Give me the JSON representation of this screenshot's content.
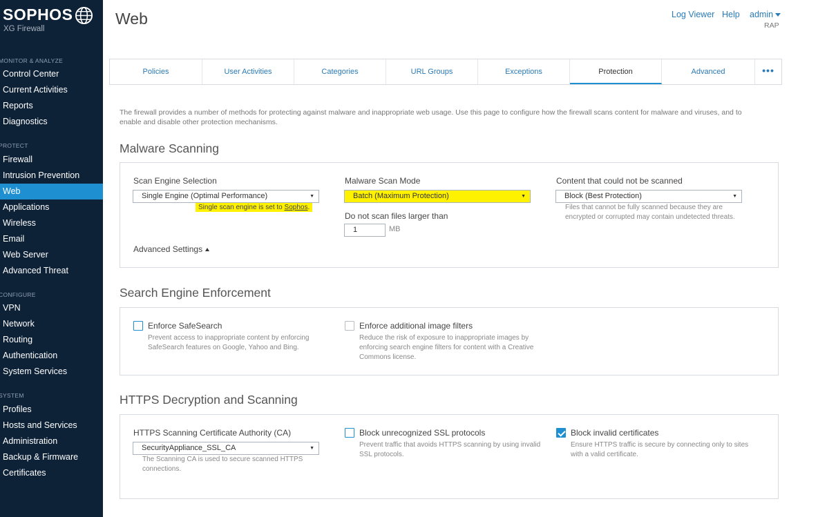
{
  "app": {
    "brand": "SOPHOS",
    "product": "XG Firewall"
  },
  "sidebar": {
    "sections": [
      {
        "label": "MONITOR & ANALYZE",
        "items": [
          "Control Center",
          "Current Activities",
          "Reports",
          "Diagnostics"
        ]
      },
      {
        "label": "PROTECT",
        "items": [
          "Firewall",
          "Intrusion Prevention",
          "Web",
          "Applications",
          "Wireless",
          "Email",
          "Web Server",
          "Advanced Threat"
        ]
      },
      {
        "label": "CONFIGURE",
        "items": [
          "VPN",
          "Network",
          "Routing",
          "Authentication",
          "System Services"
        ]
      },
      {
        "label": "SYSTEM",
        "items": [
          "Profiles",
          "Hosts and Services",
          "Administration",
          "Backup & Firmware",
          "Certificates"
        ]
      }
    ],
    "active": "Web"
  },
  "header": {
    "title": "Web",
    "links": [
      "Log Viewer",
      "Help"
    ],
    "user": "admin",
    "user_sub": "RAP"
  },
  "tabs": [
    "Policies",
    "User Activities",
    "Categories",
    "URL Groups",
    "Exceptions",
    "Protection",
    "Advanced",
    "•••"
  ],
  "active_tab": "Protection",
  "intro": "The firewall provides a number of methods for protecting against malware and inappropriate web usage. Use this page to configure how the firewall scans content for malware and viruses, and to enable and disable other protection mechanisms.",
  "malware": {
    "title": "Malware Scanning",
    "engine_label": "Scan Engine Selection",
    "engine_value": "Single Engine (Optimal Performance)",
    "engine_note_prefix": "Single scan engine is set to ",
    "engine_note_link": "Sophos",
    "engine_note_suffix": ".",
    "mode_label": "Malware Scan Mode",
    "mode_value": "Batch (Maximum Protection)",
    "size_label": "Do not scan files larger than",
    "size_value": "1",
    "size_unit": "MB",
    "unscanned_label": "Content that could not be scanned",
    "unscanned_value": "Block (Best Protection)",
    "unscanned_help": "Files that cannot be fully scanned because they are encrypted or corrupted may contain undetected threats.",
    "advanced": "Advanced Settings"
  },
  "search": {
    "title": "Search Engine Enforcement",
    "safesearch_label": "Enforce SafeSearch",
    "safesearch_checked": false,
    "safesearch_help": "Prevent access to inappropriate content by enforcing SafeSearch features on Google, Yahoo and Bing.",
    "image_label": "Enforce additional image filters",
    "image_checked": false,
    "image_help": "Reduce the risk of exposure to inappropriate images by enforcing search engine filters for content with a Creative Commons license."
  },
  "https": {
    "title": "HTTPS Decryption and Scanning",
    "ca_label": "HTTPS Scanning Certificate Authority (CA)",
    "ca_value": "SecurityAppliance_SSL_CA",
    "ca_help": "The Scanning CA is used to secure scanned HTTPS connections.",
    "ssl_label": "Block unrecognized SSL protocols",
    "ssl_checked": false,
    "ssl_help": "Prevent traffic that avoids HTTPS scanning by using invalid SSL protocols.",
    "cert_label": "Block invalid certificates",
    "cert_checked": true,
    "cert_help": "Ensure HTTPS traffic is secure by connecting only to sites with a valid certificate."
  },
  "colors": {
    "sidebar_bg": "#0d2137",
    "accent": "#1e8fd0",
    "highlight": "#fff200",
    "link": "#2a7ab5"
  }
}
